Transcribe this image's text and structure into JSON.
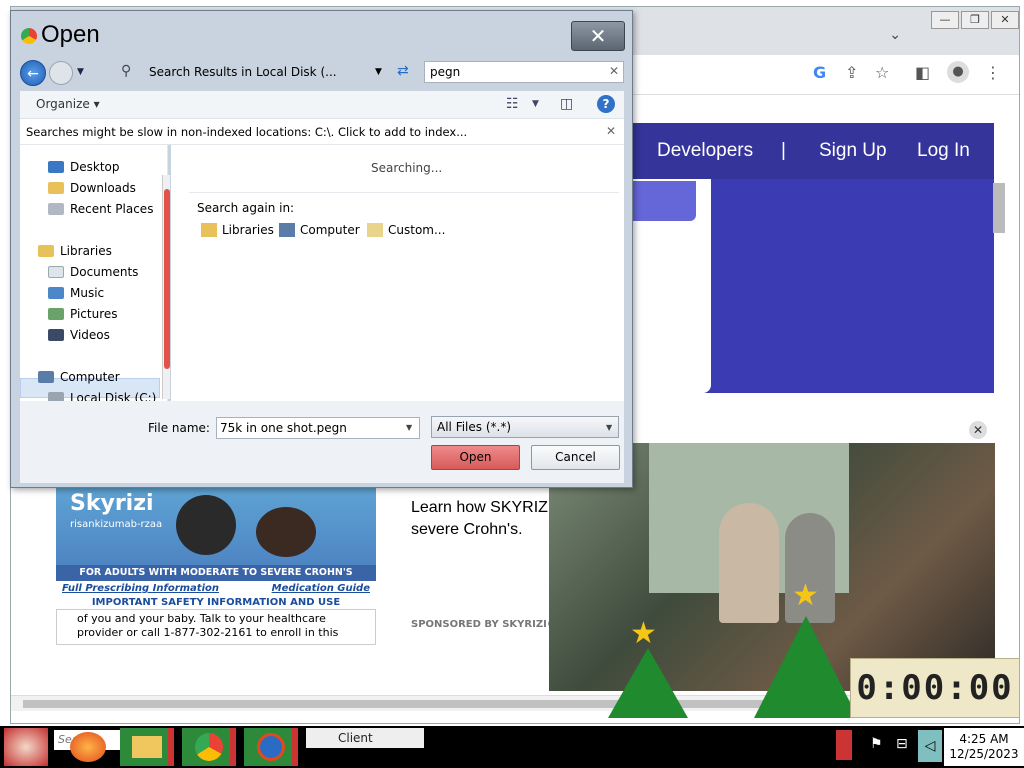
{
  "browser": {
    "nav_items": [
      "Developers",
      "|",
      "Sign Up",
      "Log In"
    ],
    "ad": {
      "brand": "Skyrizi",
      "brand_sub": "risankizumab-rzaa",
      "band_text": "FOR ADULTS WITH MODERATE TO SEVERE CROHN'S DISEASE",
      "link_prescribing": "Full Prescribing Information",
      "link_medguide": "Medication Guide",
      "safety_title": "IMPORTANT SAFETY INFORMATION AND USE",
      "safety_text": "of you and your baby. Talk to your healthcare provider or call 1-877-302-2161 to enroll in this",
      "headline": "Learn how SKYRIZI severe Crohn's.",
      "sponsored": "SPONSORED BY SKYRIZI®",
      "close": "✕"
    },
    "timer": "0:00:00"
  },
  "dialog": {
    "title": "Open",
    "close": "✕",
    "address": "Search Results in Local Disk (...",
    "search_value": "pegn",
    "organize": "Organize ▾",
    "info_message": "Searches might be slow in non-indexed locations: C:\\. Click to add to index...",
    "nav": {
      "favorites": [
        "Desktop",
        "Downloads",
        "Recent Places"
      ],
      "libraries_label": "Libraries",
      "libraries": [
        "Documents",
        "Music",
        "Pictures",
        "Videos"
      ],
      "computer_label": "Computer",
      "drive": "Local Disk (C:)"
    },
    "status": "Searching...",
    "search_again_label": "Search again in:",
    "search_again": [
      "Libraries",
      "Computer",
      "Custom..."
    ],
    "file_name_label": "File name:",
    "file_name_value": "75k in one shot.pegn",
    "file_type": "All Files (*.*)",
    "open_label": "Open",
    "cancel_label": "Cancel"
  },
  "taskbar": {
    "search_placeholder": "Search Client",
    "client_label": "Client",
    "time": "4:25 AM",
    "date": "12/25/2023"
  },
  "colors": {
    "site_nav": "#34349a",
    "open_button": "#d85a5a",
    "help_icon": "#2f72c8"
  }
}
